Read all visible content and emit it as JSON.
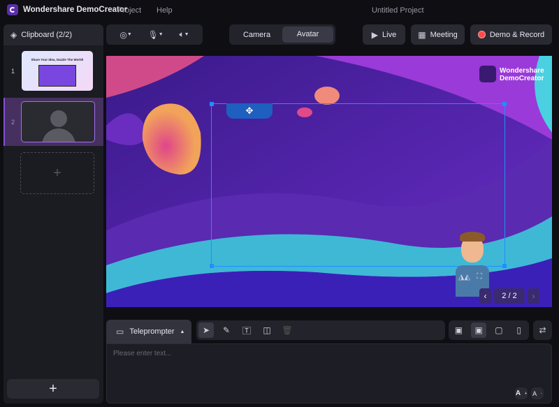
{
  "titlebar": {
    "app_name": "Wondershare DemoCreator",
    "menu": [
      "Project",
      "Help"
    ],
    "project_title": "Untitled Project"
  },
  "sidebar": {
    "title": "Clipboard (2/2)",
    "items": [
      {
        "index": "1",
        "thumb_text": "Share Your Idea, Dazzle The World!"
      },
      {
        "index": "2",
        "selected": true
      }
    ],
    "add_label": "+",
    "bottom_add": "+"
  },
  "devices": {
    "icons": [
      "webcam-icon",
      "microphone-icon",
      "speaker-icon"
    ]
  },
  "mode_tabs": [
    {
      "label": "Camera"
    },
    {
      "label": "Avatar",
      "active": true
    }
  ],
  "actions": {
    "live": "Live",
    "meeting": "Meeting",
    "record": "Demo & Record"
  },
  "preview": {
    "watermark": [
      "Wondershare",
      "DemoCreator"
    ],
    "page_indicator": "2 / 2"
  },
  "teleprompter": {
    "tab_label": "Teleprompter",
    "placeholder": "Please enter text..."
  },
  "colors": {
    "accent": "#8a4fd8",
    "record": "#ff4a4a",
    "selection": "#1e8fff"
  }
}
